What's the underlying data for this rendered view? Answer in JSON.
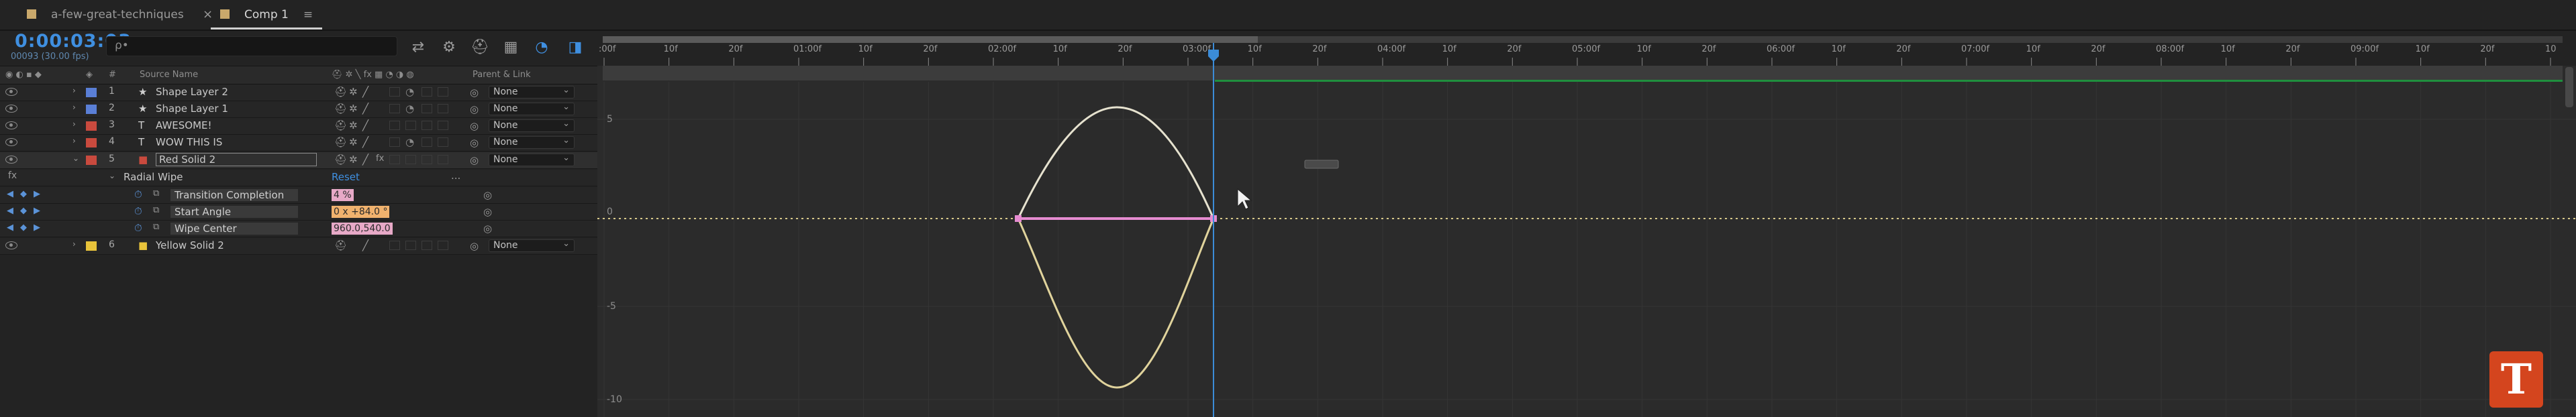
{
  "tabs": [
    {
      "label": "a-few-great-techniques",
      "active": false
    },
    {
      "label": "Comp 1",
      "active": true
    }
  ],
  "timeline": {
    "timecode": "0:00:03:03",
    "fps_info": "00093 (30.00 fps)",
    "search_placeholder": "ρ•",
    "columns": {
      "source_name": "Source Name",
      "parent_link": "Parent & Link",
      "label_hash": "#"
    },
    "layers": [
      {
        "num": "1",
        "type": "★",
        "name": "Shape Layer 2",
        "label_color": "#5a7fd6",
        "parent": "None"
      },
      {
        "num": "2",
        "type": "★",
        "name": "Shape Layer 1",
        "label_color": "#5a7fd6",
        "parent": "None"
      },
      {
        "num": "3",
        "type": "T",
        "name": "AWESOME!",
        "label_color": "#c94a3e",
        "parent": "None"
      },
      {
        "num": "4",
        "type": "T",
        "name": "WOW THIS IS",
        "label_color": "#c94a3e",
        "parent": "None"
      },
      {
        "num": "5",
        "type": "■",
        "name": "Red Solid 2",
        "label_color": "#c94a3e",
        "parent": "None"
      }
    ],
    "effect": {
      "name": "Radial Wipe",
      "reset_label": "Reset",
      "more": "...",
      "properties": [
        {
          "name": "Transition Completion",
          "value": "4 %",
          "style": "pink"
        },
        {
          "name": "Start Angle",
          "value": "0 x +84.0 °",
          "style": "orange"
        },
        {
          "name": "Wipe Center",
          "value": "960.0,540.0",
          "style": "pink"
        }
      ]
    },
    "layer6": {
      "num": "6",
      "type": "■",
      "name": "Yellow Solid 2",
      "label_color": "#e8c33a",
      "parent": "None"
    }
  },
  "ruler": {
    "labels": [
      ":00f",
      "10f",
      "20f",
      "01:00f",
      "10f",
      "20f",
      "02:00f",
      "10f",
      "20f",
      "03:00f",
      "10f",
      "20f",
      "04:00f",
      "10f",
      "20f",
      "05:00f",
      "10f",
      "20f",
      "06:00f",
      "10f",
      "20f",
      "07:00f",
      "10f",
      "20f",
      "08:00f",
      "10f",
      "20f",
      "09:00f",
      "10f",
      "20f",
      "10"
    ],
    "y_labels": [
      "5",
      "0",
      "-5",
      "-10"
    ]
  },
  "graph": {
    "playhead_time": "03:03",
    "curve_color_top": "#e6e2cf",
    "curve_color_bottom": "#e0d39c",
    "flat_line_color": "#e58bd0",
    "playhead_color": "#3b8cd8"
  },
  "logo_text": "T"
}
